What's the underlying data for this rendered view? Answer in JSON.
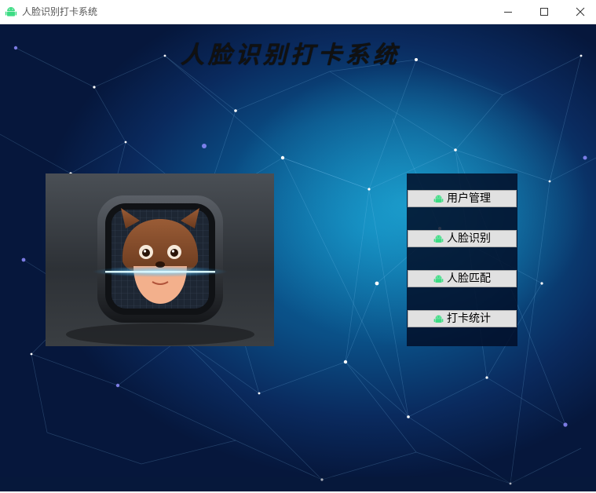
{
  "window": {
    "title": "人脸识别打卡系统",
    "icon": "android-icon",
    "controls": [
      "minimize-icon",
      "maximize-icon",
      "close-icon"
    ]
  },
  "main": {
    "heading": "人脸识别打卡系统",
    "image": "face-scan-app-icon"
  },
  "menu": {
    "items": [
      {
        "label": "用户管理",
        "icon": "android-icon"
      },
      {
        "label": "人脸识别",
        "icon": "android-icon"
      },
      {
        "label": "人脸匹配",
        "icon": "android-icon"
      },
      {
        "label": "打卡统计",
        "icon": "android-icon"
      }
    ]
  },
  "colors": {
    "android_green": "#3ddc84",
    "background_cyan": "#28c8f0",
    "background_dark": "#06173c",
    "button_face": "#e1e1e1"
  }
}
